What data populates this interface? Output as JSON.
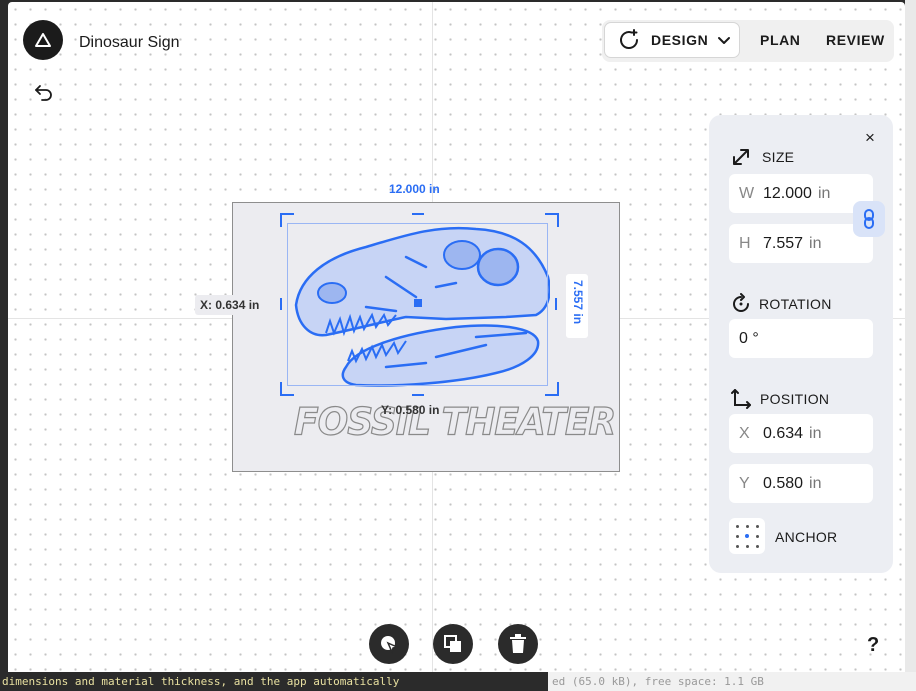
{
  "app": {
    "title": "Dinosaur Sign"
  },
  "modes": {
    "design_label": "DESIGN",
    "plan_label": "PLAN",
    "review_label": "REVIEW"
  },
  "canvas": {
    "dim_width": "12.000 in",
    "dim_height": "7.557 in",
    "dim_x": "X: 0.634 in",
    "dim_y": "Y: 0.580 in",
    "sign_text": "FOSSIL THEATER"
  },
  "panel": {
    "size_title": "SIZE",
    "width_key": "W",
    "width_value": "12.000",
    "width_unit": "in",
    "height_key": "H",
    "height_value": "7.557",
    "height_unit": "in",
    "rotation_title": "ROTATION",
    "rotation_value": "0 °",
    "position_title": "POSITION",
    "x_key": "X",
    "x_value": "0.634",
    "x_unit": "in",
    "y_key": "Y",
    "y_value": "0.580",
    "y_unit": "in",
    "anchor_title": "ANCHOR",
    "close_label": "×"
  },
  "help_label": "?",
  "terminal": {
    "left_text": "dimensions and material thickness, and the app automatically",
    "right_text": "ed (65.0 kB), free space: 1.1 GB"
  },
  "colors": {
    "accent": "#2a6df4",
    "panel_bg": "#eceef3",
    "dark": "#2b2b2b"
  },
  "icons": [
    "logo-triangle-icon",
    "undo-icon",
    "cycle-icon",
    "chevron-down-icon",
    "close-icon",
    "resize-icon",
    "link-icon",
    "rotation-icon",
    "position-icon",
    "anchor-grid-icon",
    "trace-icon",
    "duplicate-icon",
    "trash-icon"
  ]
}
